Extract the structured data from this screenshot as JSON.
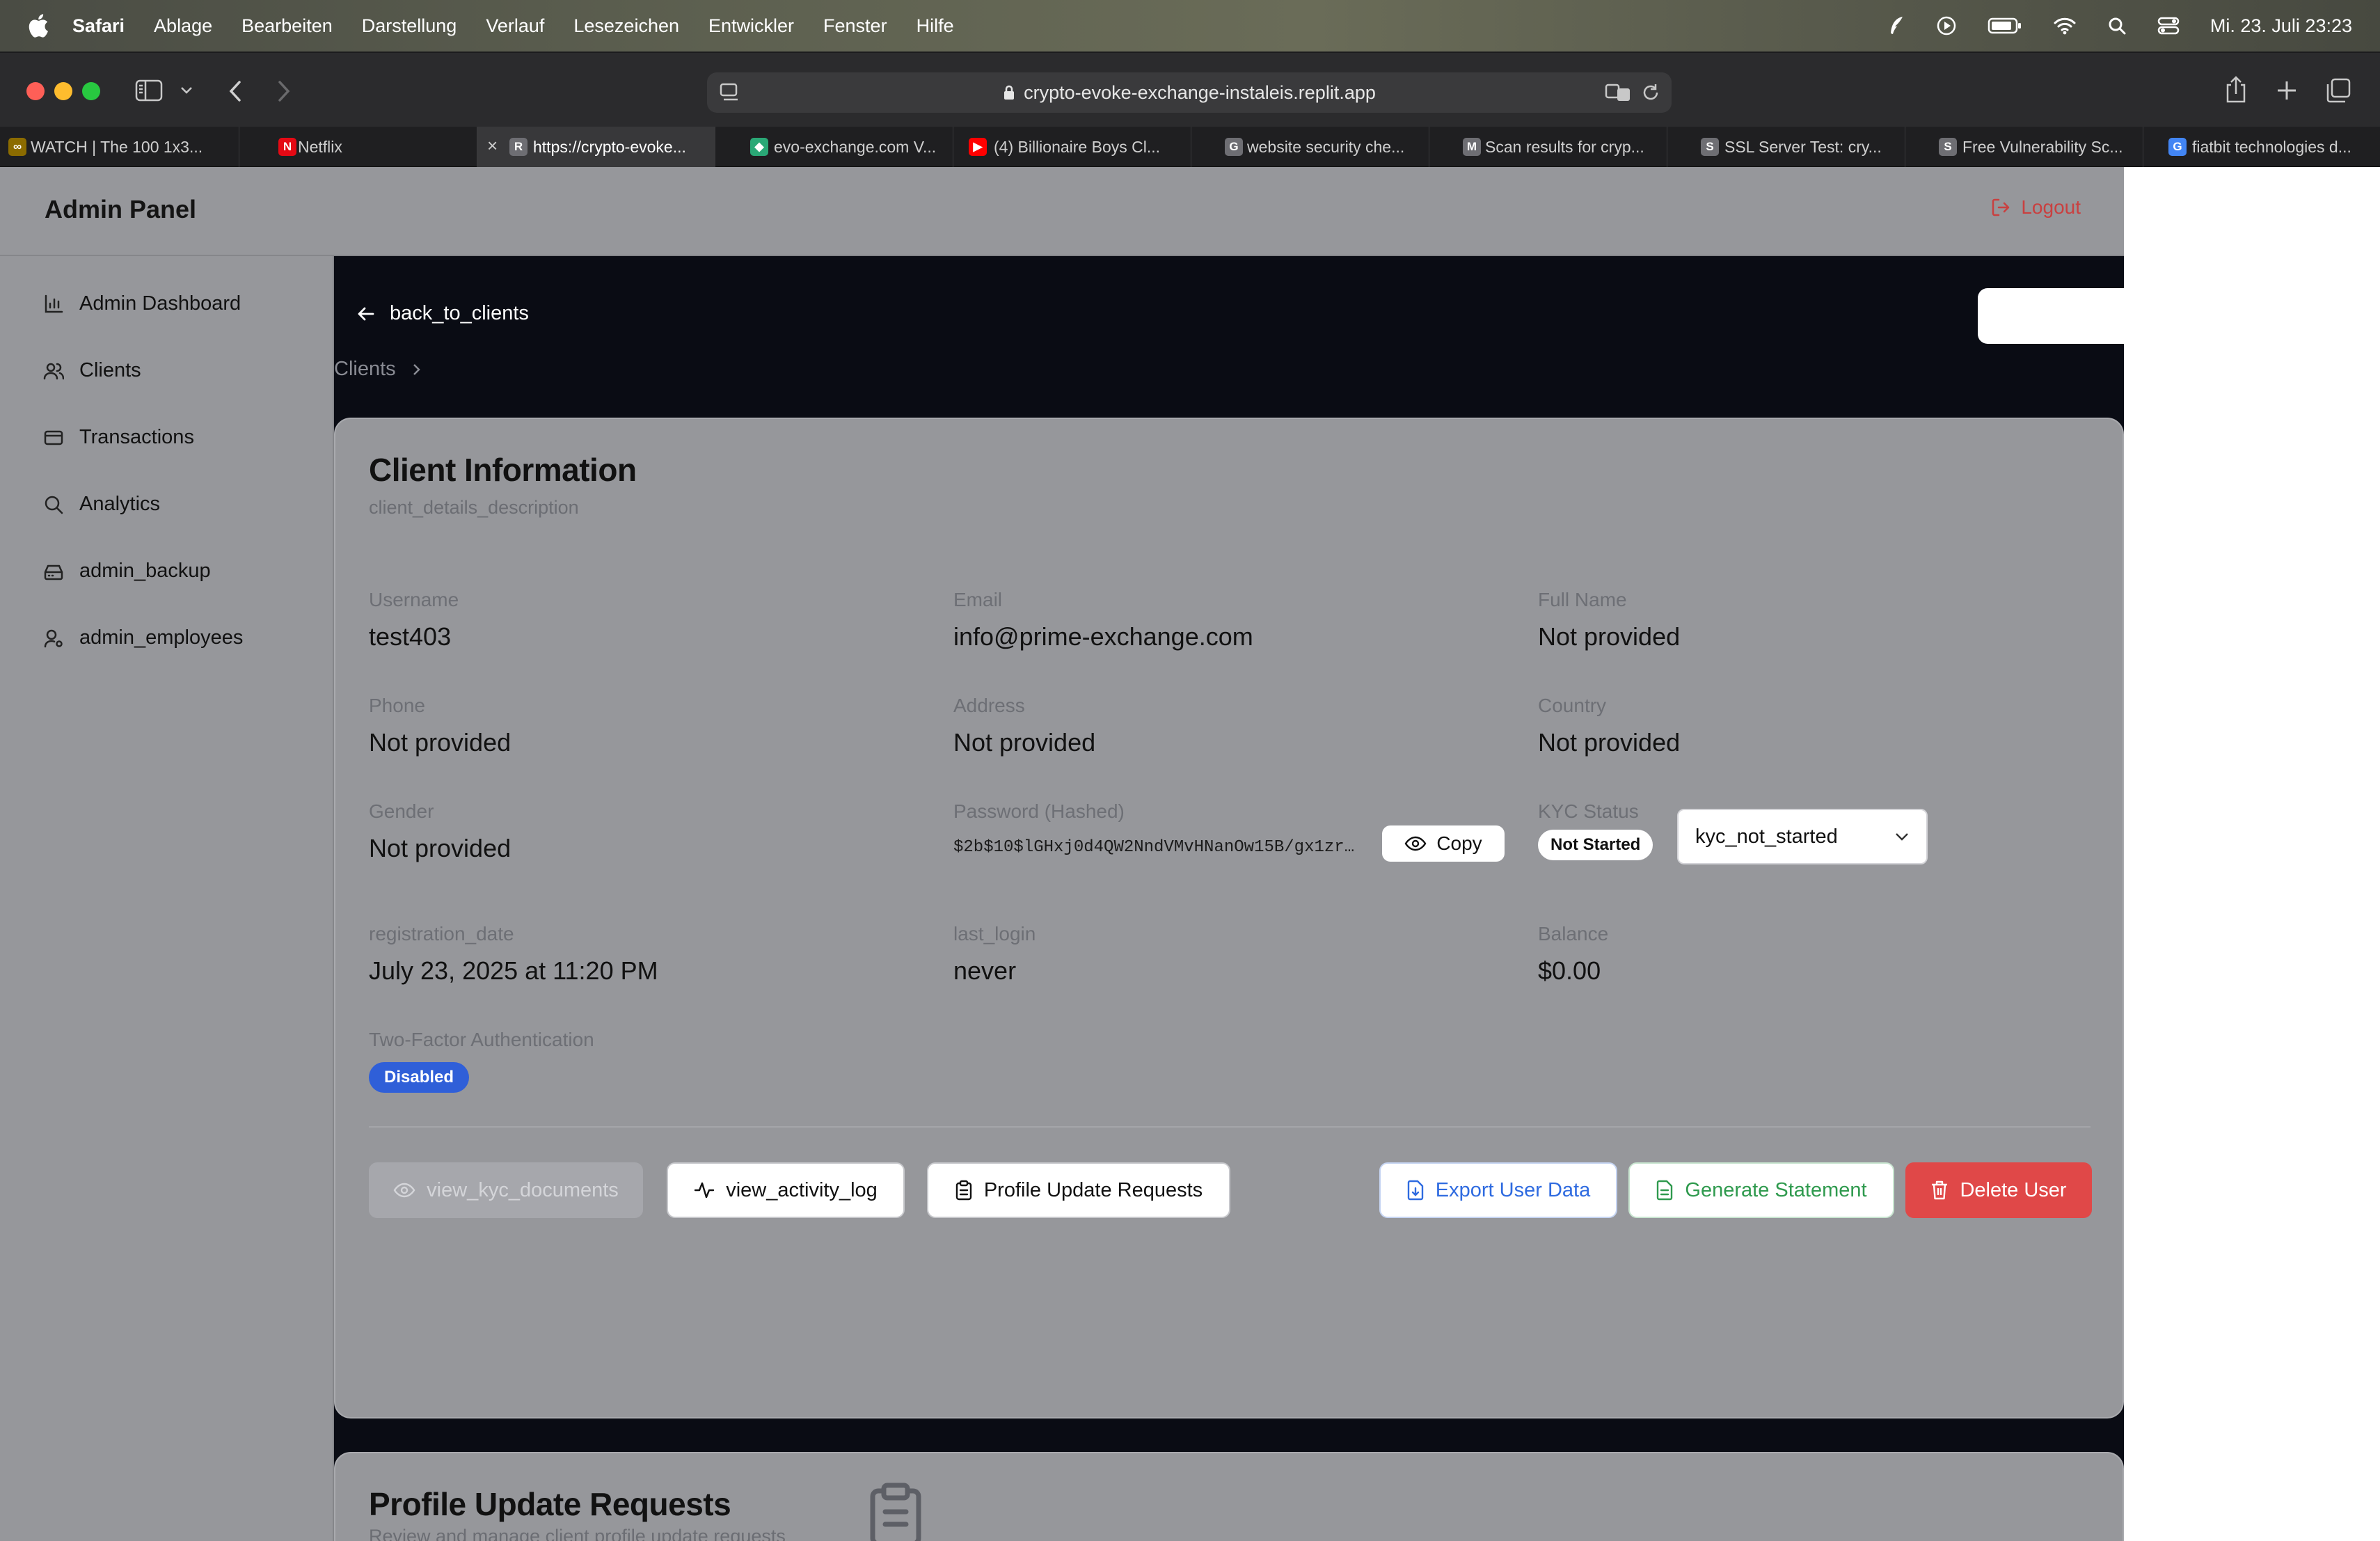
{
  "menubar": {
    "items": [
      "Safari",
      "Ablage",
      "Bearbeiten",
      "Darstellung",
      "Verlauf",
      "Lesezeichen",
      "Entwickler",
      "Fenster",
      "Hilfe"
    ],
    "clock": "Mi. 23. Juli  23:23"
  },
  "browser": {
    "url": "crypto-evoke-exchange-instaleis.replit.app",
    "tabs": [
      {
        "label": "WATCH | The 100 1x3...",
        "favicon": "∞",
        "favicon_color": "#8b6b00"
      },
      {
        "label": "Netflix",
        "favicon": "N",
        "favicon_color": "#e50914"
      },
      {
        "label": "https://crypto-evoke...",
        "favicon": "R",
        "favicon_color": "#6e6e73"
      },
      {
        "label": "evo-exchange.com V...",
        "favicon": "◆",
        "favicon_color": "#2aa876"
      },
      {
        "label": "(4) Billionaire Boys Cl...",
        "favicon": "▶",
        "favicon_color": "#ff0000"
      },
      {
        "label": "website security che...",
        "favicon": "G",
        "favicon_color": "#6e6e73"
      },
      {
        "label": "Scan results for cryp...",
        "favicon": "M",
        "favicon_color": "#6e6e73"
      },
      {
        "label": "SSL Server Test: cry...",
        "favicon": "S",
        "favicon_color": "#6e6e73"
      },
      {
        "label": "Free Vulnerability Sc...",
        "favicon": "S",
        "favicon_color": "#6e6e73"
      },
      {
        "label": "fiatbit technologies d...",
        "favicon": "G",
        "favicon_color": "#4285f4"
      }
    ]
  },
  "app": {
    "brand": "Admin Panel",
    "logout": "Logout",
    "sidebar": [
      "Admin Dashboard",
      "Clients",
      "Transactions",
      "Analytics",
      "admin_backup",
      "admin_employees"
    ],
    "back": "back_to_clients",
    "breadcrumb": "Clients"
  },
  "client": {
    "title": "Client Information",
    "subtitle": "client_details_description",
    "username_label": "Username",
    "username": "test403",
    "email_label": "Email",
    "email": "info@prime-exchange.com",
    "fullname_label": "Full Name",
    "fullname": "Not provided",
    "phone_label": "Phone",
    "phone": "Not provided",
    "address_label": "Address",
    "address": "Not provided",
    "country_label": "Country",
    "country": "Not provided",
    "gender_label": "Gender",
    "gender": "Not provided",
    "password_label": "Password (Hashed)",
    "password_hash": "$2b$10$lGHxj0d4QW2NndVMvHNanOw15B/gx1zr…",
    "copy": "Copy",
    "kyc_label": "KYC Status",
    "kyc_badge": "Not Started",
    "kyc_select": "kyc_not_started",
    "regdate_label": "registration_date",
    "regdate": "July 23, 2025 at 11:20 PM",
    "lastlogin_label": "last_login",
    "lastlogin": "never",
    "balance_label": "Balance",
    "balance": "$0.00",
    "twofa_label": "Two-Factor Authentication",
    "twofa": "Disabled"
  },
  "actions": {
    "view_kyc": "view_kyc_documents",
    "view_activity": "view_activity_log",
    "profile_updates": "Profile Update Requests",
    "export": "Export User Data",
    "statement": "Generate Statement",
    "delete": "Delete User"
  },
  "profile_requests": {
    "title": "Profile Update Requests",
    "subtitle": "Review and manage client profile update requests"
  }
}
